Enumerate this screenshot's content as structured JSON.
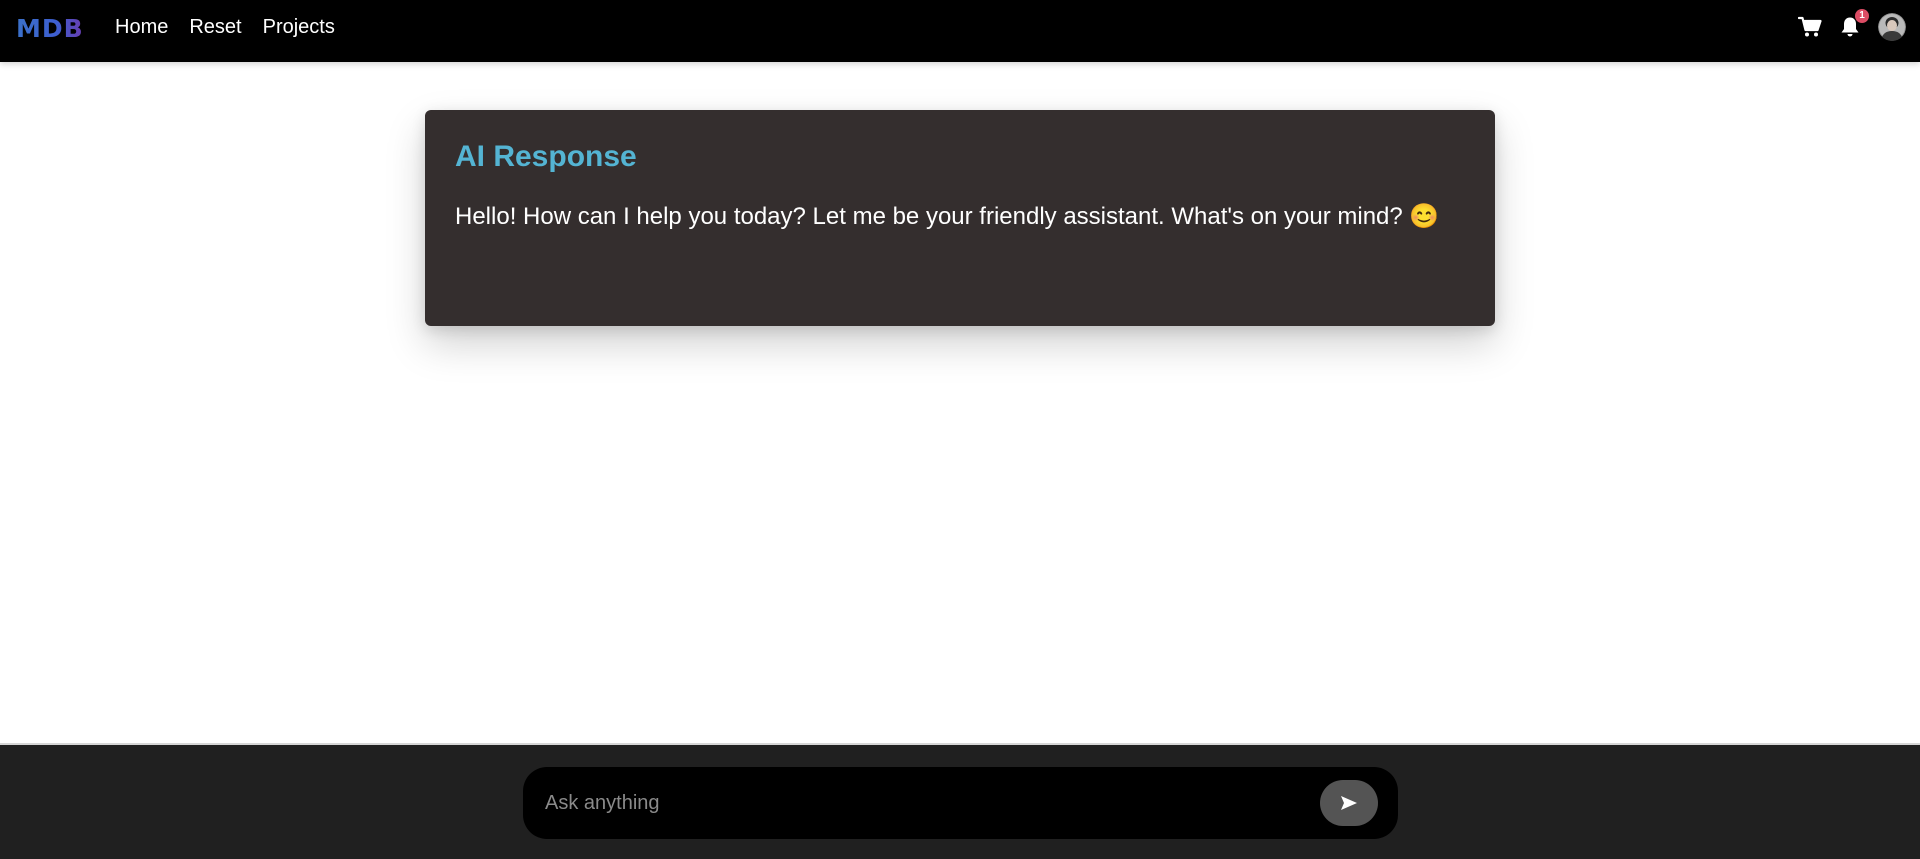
{
  "navbar": {
    "brand": "MDB",
    "links": [
      "Home",
      "Reset",
      "Projects"
    ],
    "notification_count": "1",
    "icons": {
      "cart": "cart-icon",
      "bell": "bell-icon",
      "avatar": "avatar"
    }
  },
  "response": {
    "title": "AI Response",
    "text": "Hello! How can I help you today? Let me be your friendly assistant. What's on your mind? 😊"
  },
  "input": {
    "placeholder": "Ask anything",
    "value": "",
    "send_icon": "send-icon"
  },
  "colors": {
    "navbar_bg": "#000000",
    "card_bg": "#342e2e",
    "title_accent": "#54b4d3",
    "badge": "#dc4c64",
    "footer_bg": "#202020",
    "send_button": "#545454"
  }
}
